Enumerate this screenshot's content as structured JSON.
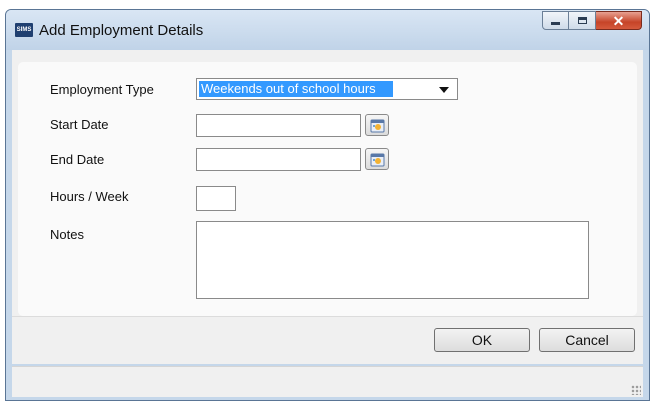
{
  "window": {
    "title": "Add Employment Details",
    "app_icon_text": "SIMS"
  },
  "form": {
    "employment_type": {
      "label": "Employment Type",
      "selected": "Weekends out of school hours"
    },
    "start_date": {
      "label": "Start Date",
      "value": ""
    },
    "end_date": {
      "label": "End Date",
      "value": ""
    },
    "hours_week": {
      "label": "Hours / Week",
      "value": ""
    },
    "notes": {
      "label": "Notes",
      "value": ""
    }
  },
  "buttons": {
    "ok": "OK",
    "cancel": "Cancel"
  },
  "icons": {
    "app": "sims-logo-icon",
    "calendar": "calendar-icon",
    "minimize": "minimize-icon",
    "maximize": "maximize-icon",
    "close": "close-icon",
    "dropdown": "chevron-down-icon",
    "grip": "resize-grip-icon"
  }
}
